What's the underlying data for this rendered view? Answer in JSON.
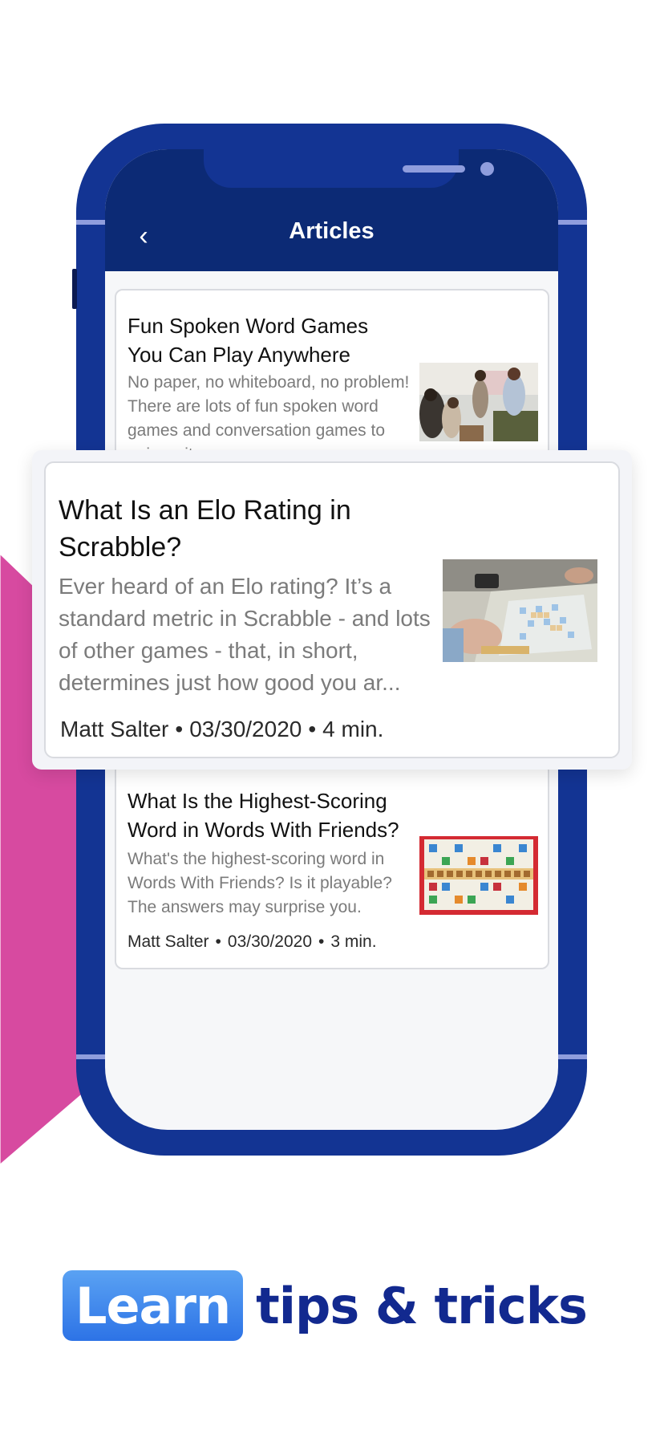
{
  "header": {
    "back_icon": "chevron-left-icon",
    "back_glyph": "‹",
    "title": "Articles"
  },
  "articles": [
    {
      "title": "Fun Spoken Word Games You Can Play Anywhere",
      "excerpt": "No paper, no whiteboard, no problem! There are lots of fun spoken word games and conversation games to enjoy wit...",
      "thumbnail": "people-playing-photo"
    },
    {
      "title": "What Is an Elo Rating in Scrabble?",
      "excerpt": "Ever heard of an Elo rating? It’s a standard metric in Scrabble - and lots of other games - that, in short, determines just how good you ar...",
      "author": "Matt Salter",
      "date": "03/30/2020",
      "read_time": "4 min.",
      "separator": "•",
      "thumbnail": "scrabble-board-photo"
    },
    {
      "title": "What Is the Highest-Scoring Word in Words With Friends?",
      "excerpt": "What's the highest-scoring word in Words With Friends? Is it playable? The answers may surprise you.",
      "author": "Matt Salter",
      "date": "03/30/2020",
      "read_time": "3 min.",
      "separator": "•",
      "thumbnail": "words-with-friends-board-photo"
    }
  ],
  "headline": {
    "highlight": "Learn",
    "rest": "tips & tricks"
  },
  "colors": {
    "phone_body": "#133493",
    "header_bg": "#0c2a75",
    "pink_accent": "#d74aa0",
    "headline_text": "#12298f",
    "learn_pill": "#3d85ee"
  }
}
